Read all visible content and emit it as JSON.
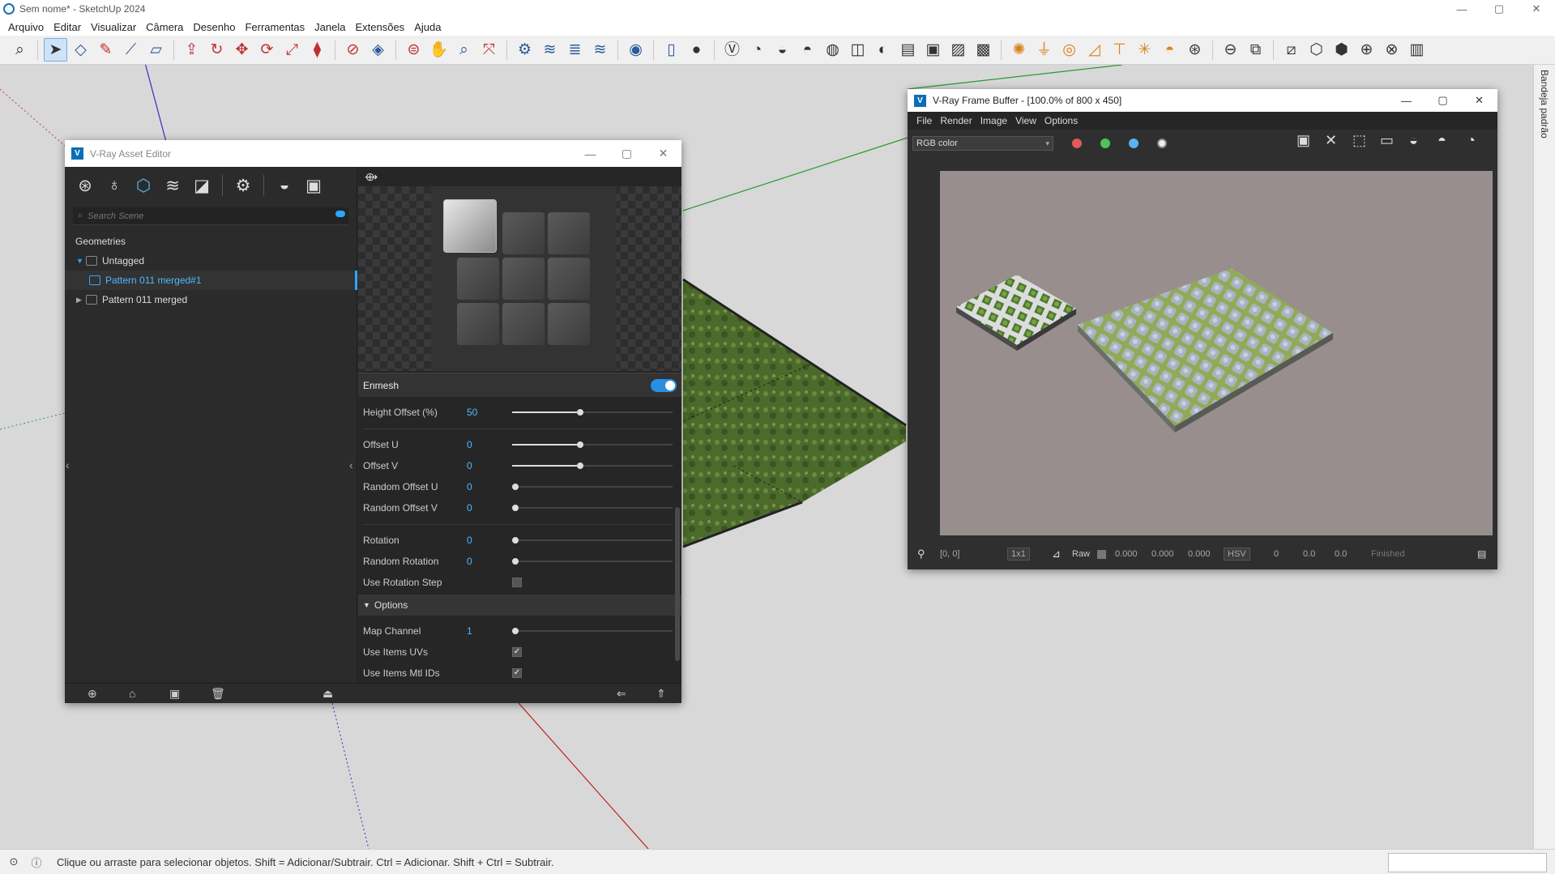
{
  "app": {
    "title": "Sem nome* - SketchUp 2024",
    "window_controls": {
      "minimize": "—",
      "maximize": "▢",
      "close": "✕"
    }
  },
  "menu": [
    "Arquivo",
    "Editar",
    "Visualizar",
    "Câmera",
    "Desenho",
    "Ferramentas",
    "Janela",
    "Extensões",
    "Ajuda"
  ],
  "tray": {
    "label": "Bandeja padrão"
  },
  "status": {
    "message": "Clique ou arraste para selecionar objetos. Shift = Adicionar/Subtrair. Ctrl = Adicionar. Shift + Ctrl = Subtrair."
  },
  "asset_editor": {
    "title": "V-Ray Asset Editor",
    "search_placeholder": "Search Scene",
    "category": "Geometries",
    "tree": [
      {
        "label": "Untagged"
      },
      {
        "label": "Pattern 011 merged#1",
        "selected": true
      },
      {
        "label": "Pattern 011 merged"
      }
    ],
    "enmesh_label": "Enmesh",
    "enmesh_enabled": true,
    "params": [
      {
        "label": "Height Offset (%)",
        "value": "50",
        "slider": 0.5
      },
      {
        "label": "Offset U",
        "value": "0",
        "slider": 0.5
      },
      {
        "label": "Offset V",
        "value": "0",
        "slider": 0.5
      },
      {
        "label": "Random Offset U",
        "value": "0",
        "slider": 0.0
      },
      {
        "label": "Random Offset V",
        "value": "0",
        "slider": 0.0
      },
      {
        "label": "Rotation",
        "value": "0",
        "slider": 0.0
      },
      {
        "label": "Random Rotation",
        "value": "0",
        "slider": 0.0
      },
      {
        "label": "Use Rotation Step",
        "checked": false
      }
    ],
    "options_section": "Options",
    "options": [
      {
        "label": "Map Channel",
        "value": "1",
        "slider": 0.0
      },
      {
        "label": "Use Items UVs",
        "checked": true
      },
      {
        "label": "Use Items Mtl IDs",
        "checked": true
      }
    ]
  },
  "frame_buffer": {
    "title": "V-Ray Frame Buffer - [100.0% of 800 x 450]",
    "menu": [
      "File",
      "Render",
      "Image",
      "View",
      "Options"
    ],
    "channel": "RGB color",
    "coords": "[0, 0]",
    "zoom": "1x1",
    "raw_label": "Raw",
    "raw_values": [
      "0.000",
      "0.000",
      "0.000"
    ],
    "color_mode": "HSV",
    "hsv_values": [
      "0",
      "0.0",
      "0.0"
    ],
    "render_status": "Finished"
  },
  "colors": {
    "accent": "#2aa7ff",
    "render_bg": "#978e8d",
    "viewport_bg": "#d8d8d8"
  }
}
